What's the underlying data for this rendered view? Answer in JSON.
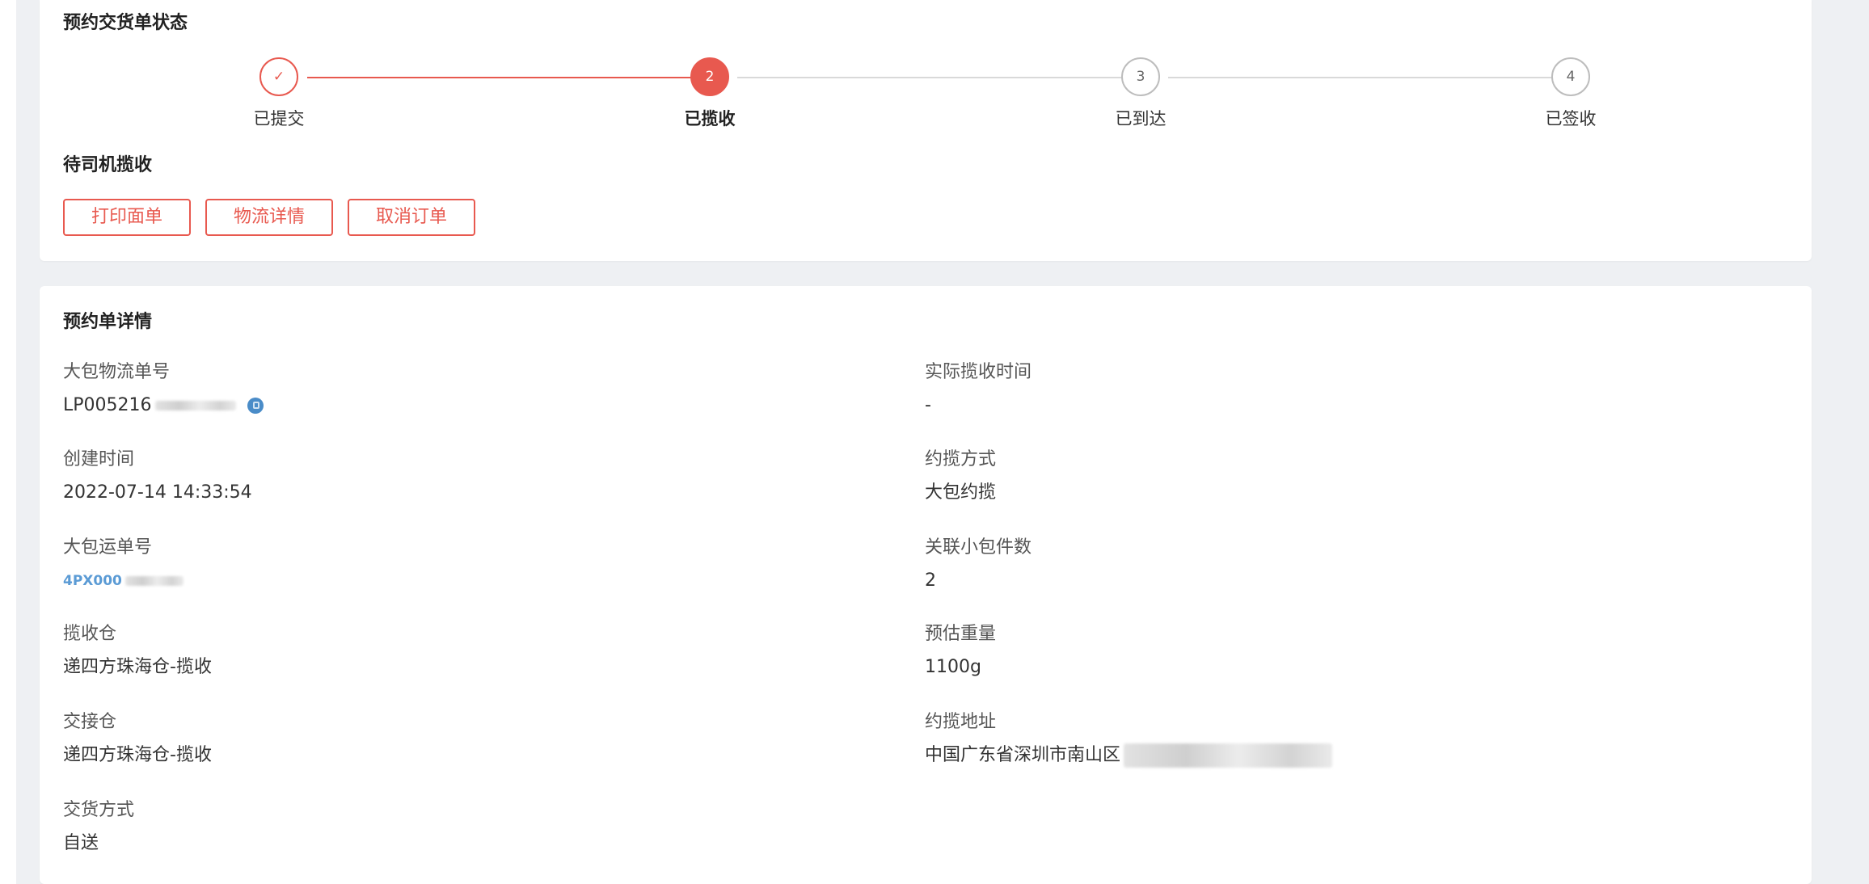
{
  "status_card": {
    "title": "预约交货单状态",
    "steps": [
      {
        "num": "✓",
        "label": "已提交",
        "state": "done"
      },
      {
        "num": "2",
        "label": "已揽收",
        "state": "current"
      },
      {
        "num": "3",
        "label": "已到达",
        "state": "pending"
      },
      {
        "num": "4",
        "label": "已签收",
        "state": "pending"
      }
    ],
    "status_text": "待司机揽收",
    "buttons": {
      "print": "打印面单",
      "logistics": "物流详情",
      "cancel": "取消订单"
    }
  },
  "detail_card": {
    "title": "预约单详情",
    "left": [
      {
        "label": "大包物流单号",
        "value": "LP005216"
      },
      {
        "label": "创建时间",
        "value": "2022-07-14 14:33:54"
      },
      {
        "label": "大包运单号",
        "value": "4PX000"
      },
      {
        "label": "揽收仓",
        "value": "递四方珠海仓-揽收"
      },
      {
        "label": "交接仓",
        "value": "递四方珠海仓-揽收"
      },
      {
        "label": "交货方式",
        "value": "自送"
      }
    ],
    "right": [
      {
        "label": "实际揽收时间",
        "value": "-"
      },
      {
        "label": "约揽方式",
        "value": "大包约揽"
      },
      {
        "label": "关联小包件数",
        "value": "2"
      },
      {
        "label": "预估重量",
        "value": "1100g"
      },
      {
        "label": "约揽地址",
        "value": "中国广东省深圳市南山区"
      }
    ]
  },
  "colors": {
    "accent": "#e8594f",
    "link": "#5b9bd5",
    "background": "#eef0f3"
  }
}
